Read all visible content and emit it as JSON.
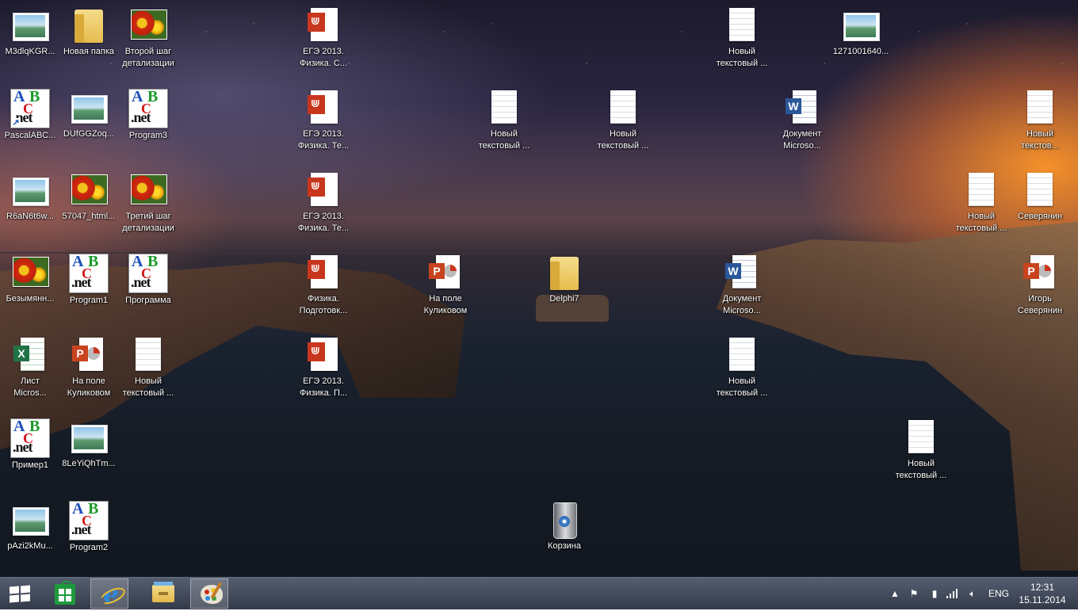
{
  "desktop": {
    "icons": [
      {
        "id": "m3dlq",
        "label": "M3dlqKGR...",
        "type": "picture"
      },
      {
        "id": "new-folder",
        "label": "Новая папка",
        "type": "folder"
      },
      {
        "id": "step2",
        "label": "Второй шаг\nдетализации",
        "type": "flower"
      },
      {
        "id": "ege1",
        "label": "ЕГЭ 2013.\nФизика. С...",
        "type": "pdf"
      },
      {
        "id": "txt-top1",
        "label": "Новый\nтекстовый ...",
        "type": "txt"
      },
      {
        "id": "img127",
        "label": "1271001640...",
        "type": "picture"
      },
      {
        "id": "pascalabc",
        "label": "PascalABC...",
        "type": "abc-shortcut"
      },
      {
        "id": "dufgg",
        "label": "DUfGGZoq...",
        "type": "picture"
      },
      {
        "id": "program3",
        "label": "Program3",
        "type": "abc"
      },
      {
        "id": "ege2",
        "label": "ЕГЭ 2013.\nФизика. Те...",
        "type": "pdf"
      },
      {
        "id": "txt-a",
        "label": "Новый\nтекстовый ...",
        "type": "txt"
      },
      {
        "id": "txt-b",
        "label": "Новый\nтекстовый ...",
        "type": "txt"
      },
      {
        "id": "doc1",
        "label": "Документ\nMicroso...",
        "type": "word"
      },
      {
        "id": "txt-right1",
        "label": "Новый\nтекстов...",
        "type": "txt"
      },
      {
        "id": "r6an",
        "label": "R6aN6t6w...",
        "type": "picture"
      },
      {
        "id": "html57047",
        "label": "57047_html...",
        "type": "flower"
      },
      {
        "id": "step3",
        "label": "Третий шаг\nдетализации",
        "type": "flower"
      },
      {
        "id": "ege3",
        "label": "ЕГЭ 2013.\nФизика. Те...",
        "type": "pdf"
      },
      {
        "id": "txt-right2",
        "label": "Новый\nтекстовый ...",
        "type": "txt"
      },
      {
        "id": "severyanin",
        "label": "Северянин",
        "type": "txt"
      },
      {
        "id": "nameless",
        "label": "Безымянн...",
        "type": "flower"
      },
      {
        "id": "program1",
        "label": "Program1",
        "type": "abc"
      },
      {
        "id": "programma",
        "label": "Программа",
        "type": "abc"
      },
      {
        "id": "physics-prep",
        "label": "Физика.\nПодготовк...",
        "type": "pdf"
      },
      {
        "id": "kulikovo1",
        "label": "На поле\nКуликовом",
        "type": "ppt"
      },
      {
        "id": "delphi7",
        "label": "Delphi7",
        "type": "folder"
      },
      {
        "id": "doc2",
        "label": "Документ\nMicroso...",
        "type": "word"
      },
      {
        "id": "igor",
        "label": "Игорь\nСеверянин",
        "type": "ppt"
      },
      {
        "id": "excel",
        "label": "Лист\nMicros...",
        "type": "excel"
      },
      {
        "id": "kulikovo2",
        "label": "На поле\nКуликовом",
        "type": "ppt"
      },
      {
        "id": "txt-c",
        "label": "Новый\nтекстовый ...",
        "type": "txt"
      },
      {
        "id": "ege4",
        "label": "ЕГЭ 2013.\nФизика. П...",
        "type": "pdf"
      },
      {
        "id": "txt-d",
        "label": "Новый\nтекстовый ...",
        "type": "txt"
      },
      {
        "id": "primer1",
        "label": "Пример1",
        "type": "abc"
      },
      {
        "id": "8leyi",
        "label": "8LeYiQhTm...",
        "type": "picture"
      },
      {
        "id": "txt-e",
        "label": "Новый\nтекстовый ...",
        "type": "txt"
      },
      {
        "id": "pazi",
        "label": "pAzi2kMu...",
        "type": "picture"
      },
      {
        "id": "program2",
        "label": "Program2",
        "type": "abc"
      },
      {
        "id": "recycle",
        "label": "Корзина",
        "type": "bin"
      }
    ]
  },
  "taskbar": {
    "buttons": [
      {
        "name": "start-button",
        "icon": "windows-logo-icon"
      },
      {
        "name": "store-button",
        "icon": "store-icon"
      },
      {
        "name": "internet-explorer-button",
        "icon": "internet-explorer-icon"
      },
      {
        "name": "file-explorer-button",
        "icon": "folder-icon"
      },
      {
        "name": "paint-button",
        "icon": "paint-palette-icon"
      }
    ],
    "tray": {
      "language": "ENG",
      "time": "12:31",
      "date": "15.11.2014",
      "icons": [
        "show-hidden-icons-arrow",
        "action-center-flag-icon",
        "power-icon",
        "network-signal-icon",
        "volume-icon"
      ]
    }
  },
  "colors": {
    "taskbar": "#2c3446",
    "label_text": "#ffffff"
  }
}
